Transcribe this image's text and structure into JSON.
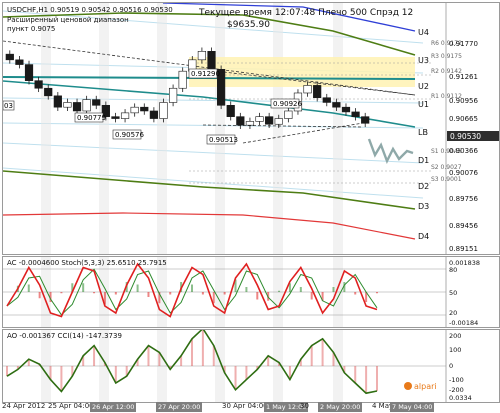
{
  "header": {
    "line1": "USDCHF,H1  0.90519 0.90542 0.90516 0.90530",
    "line2": "Расширенный ценовой диапазон",
    "line3": "пункт 0.9075",
    "server_time": "Текущее время 12:07:48 Плечо 500 Спрэд 12",
    "balance": "$9635.90"
  },
  "levels": [
    "U4",
    "U3",
    "U2",
    "U1",
    "LB",
    "D1",
    "D2",
    "D3",
    "D4"
  ],
  "pivots": [
    "R3 0.9175",
    "R2 0.9142",
    "R1 0.9112",
    "R6 0.9172",
    "S1 0.9045",
    "S2 0.9027",
    "S3 0.9001"
  ],
  "price_scale": [
    "0.91770",
    "0.91261",
    "0.90956",
    "0.90665",
    "0.90530",
    "0.90366",
    "0.90076",
    "0.89756",
    "0.89456",
    "0.89151"
  ],
  "current_price": "0.90530",
  "point_labels": [
    "0.91290",
    "0.90779",
    "0.90576",
    "0.90513",
    "0.90926",
    "03"
  ],
  "stoch": {
    "title": "AC -0.0004600  Stoch(5,3,3) 25.6510 25.7915",
    "scale": [
      "0.001838",
      "80",
      "50",
      "20",
      "-0.00184"
    ]
  },
  "ao": {
    "title": "AO -0.001367  CCI(14) -147.3739",
    "scale": [
      "200",
      "100",
      "0",
      "-100",
      "-200",
      "0.0334"
    ]
  },
  "brand": "alpari",
  "dates": [
    "24 Apr 2012",
    "25 Apr 04:00",
    "26 Apr 12:00",
    "27 Apr 20:00",
    "30 Apr 04:00",
    "1 May 12:00",
    "2 May 20:00",
    "4 May 04:00",
    "30",
    "7 May 04:00"
  ],
  "colors": {
    "candles": "#1a1a1a",
    "resistance_teal": "#1e8c8c",
    "olive_band": "#4e7d14",
    "blue_line": "#2f3fd6",
    "red_line": "#e23838",
    "light_blue": "#9fcfe3",
    "yellow_zone": "#fff2b3",
    "stoch_main": "#e02020",
    "stoch_signal": "#2e8b2e",
    "ao_line": "#2e6d12",
    "cci_bars": "#e06060",
    "price_box": "#2e2e2e"
  },
  "chart_data": [
    {
      "type": "line",
      "title": "USDCHF,H1",
      "x": [
        1,
        10,
        20,
        30,
        40,
        50,
        60,
        70,
        80,
        90,
        100,
        110,
        120,
        130,
        140,
        150,
        160,
        170,
        180,
        190,
        200,
        210,
        220,
        230,
        240,
        250,
        260,
        270,
        280,
        290,
        300,
        310,
        320,
        330,
        340,
        350,
        360,
        370
      ],
      "series": [
        {
          "name": "USDCHF",
          "values": [
            0.912,
            0.9115,
            0.9098,
            0.909,
            0.9082,
            0.907,
            0.9075,
            0.9066,
            0.9078,
            0.9072,
            0.906,
            0.9058,
            0.9064,
            0.907,
            0.9066,
            0.9058,
            0.9075,
            0.909,
            0.9108,
            0.912,
            0.9129,
            0.911,
            0.9072,
            0.906,
            0.9051,
            0.9055,
            0.906,
            0.9052,
            0.9058,
            0.9066,
            0.9085,
            0.9093,
            0.908,
            0.9075,
            0.907,
            0.9065,
            0.906,
            0.9053
          ]
        }
      ],
      "ylim": [
        0.8915,
        0.918
      ]
    },
    {
      "type": "line",
      "title": "AC -0.0004600  Stoch(5,3,3) 25.6510 25.7915",
      "series": [
        {
          "name": "Stoch",
          "values": [
            30,
            55,
            85,
            60,
            20,
            15,
            50,
            85,
            80,
            30,
            20,
            60,
            90,
            70,
            25,
            15,
            55,
            85,
            75,
            30,
            20,
            70,
            90,
            60,
            25,
            30,
            65,
            85,
            55,
            20,
            40,
            80,
            70,
            30,
            25
          ]
        }
      ],
      "ylim": [
        0,
        100
      ]
    },
    {
      "type": "line",
      "title": "AO -0.001367  CCI(14) -147.3739",
      "series": [
        {
          "name": "CCI",
          "values": [
            -60,
            -20,
            40,
            10,
            -80,
            -150,
            -60,
            60,
            120,
            20,
            -100,
            -60,
            40,
            120,
            80,
            -20,
            60,
            160,
            220,
            120,
            -40,
            -140,
            -80,
            -20,
            60,
            20,
            -80,
            40,
            120,
            160,
            80,
            -40,
            -100,
            -160,
            -147
          ]
        }
      ],
      "ylim": [
        -200,
        200
      ]
    }
  ]
}
